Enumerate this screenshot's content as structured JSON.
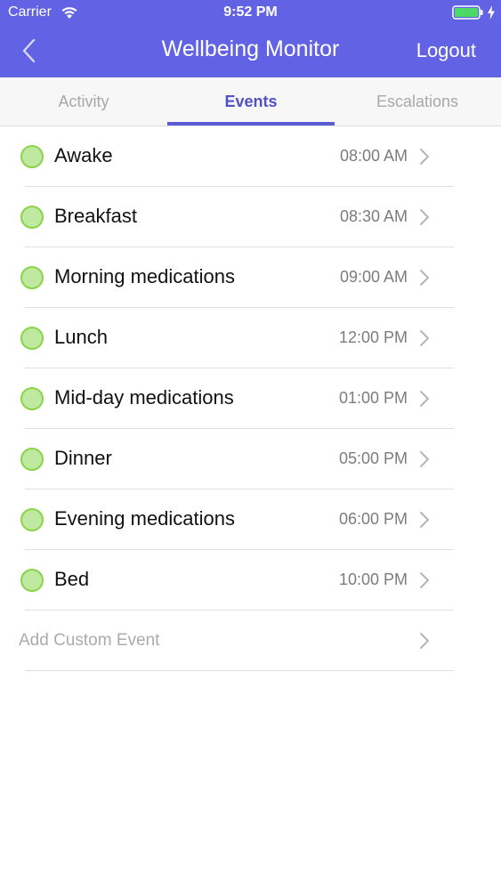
{
  "status_bar": {
    "carrier": "Carrier",
    "time": "9:52 PM",
    "wifi_icon": "wifi-icon",
    "battery_icon": "battery-icon",
    "charging_icon": "bolt-icon"
  },
  "nav": {
    "back_icon": "chevron-left-icon",
    "title": "Wellbeing Monitor",
    "logout_label": "Logout"
  },
  "tabs": [
    {
      "label": "Activity",
      "active": false
    },
    {
      "label": "Events",
      "active": true
    },
    {
      "label": "Escalations",
      "active": false
    }
  ],
  "events": [
    {
      "label": "Awake",
      "time": "08:00 AM",
      "status": "complete"
    },
    {
      "label": "Breakfast",
      "time": "08:30 AM",
      "status": "complete"
    },
    {
      "label": "Morning medications",
      "time": "09:00 AM",
      "status": "complete"
    },
    {
      "label": "Lunch",
      "time": "12:00 PM",
      "status": "complete"
    },
    {
      "label": "Mid-day medications",
      "time": "01:00 PM",
      "status": "complete"
    },
    {
      "label": "Dinner",
      "time": "05:00 PM",
      "status": "complete"
    },
    {
      "label": "Evening medications",
      "time": "06:00 PM",
      "status": "complete"
    },
    {
      "label": "Bed",
      "time": "10:00 PM",
      "status": "complete"
    }
  ],
  "add_custom": {
    "label": "Add Custom Event"
  },
  "colors": {
    "header": "#6162e4",
    "accent": "#5152c6",
    "status_fill": "#bfe8a0",
    "status_border": "#8ad44a"
  }
}
